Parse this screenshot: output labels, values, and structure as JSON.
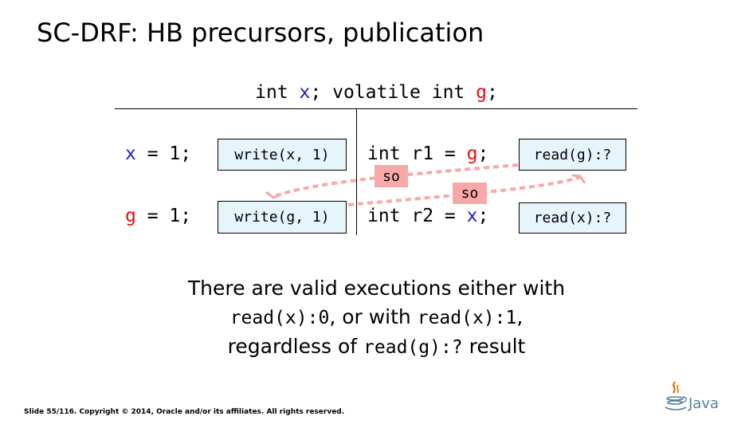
{
  "slide": {
    "title": "SC-DRF: HB precursors, publication",
    "declaration": {
      "p1": "int ",
      "x": "x",
      "p2": "; volatile int ",
      "g": "g",
      "p3": ";"
    },
    "thread1": {
      "line1_var": "x",
      "line1_rest": " = 1;",
      "line1_action": "write(x, 1)",
      "line2_var": "g",
      "line2_rest": " = 1;",
      "line2_action": "write(g, 1)"
    },
    "thread2": {
      "line1_pre": "int r1 = ",
      "line1_var": "g",
      "line1_post": ";",
      "line1_action": "read(g):?",
      "line2_pre": "int r2 = ",
      "line2_var": "x",
      "line2_post": ";",
      "line2_action": "read(x):?"
    },
    "so_labels": [
      "so",
      "so"
    ],
    "caption": {
      "line1": "There are valid executions either with",
      "c1": "read(x):0",
      "t1": ", or with ",
      "c2": "read(x):1",
      "t2": ",",
      "t3": "regardless of ",
      "c3": "read(g):?",
      "t4": " result"
    },
    "footer": "Slide 55/116. Copyright © 2014, Oracle and/or its affiliates. All rights reserved.",
    "logo_text": "Java"
  },
  "colors": {
    "shared_x": "#1a1acc",
    "volatile_g": "#dd1111",
    "action_box": "#e6f4fb",
    "so_edge": "#f8a8a8"
  }
}
